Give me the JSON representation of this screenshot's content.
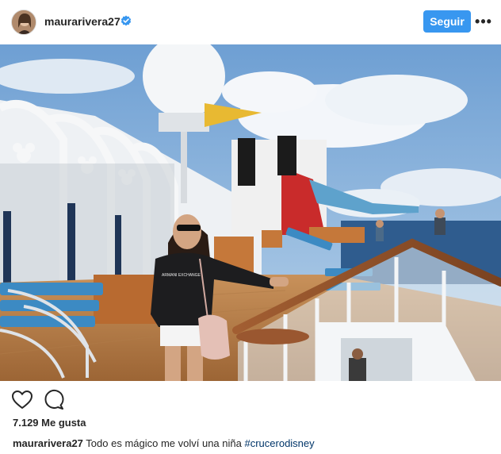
{
  "post": {
    "username": "maurarivera27",
    "verified": true,
    "follow_label": "Seguir",
    "more_icon": "more-options-icon",
    "accent_color": "#3897f0",
    "likes_text": "7.129 Me gusta",
    "caption_user": "maurarivera27",
    "caption_text": "Todo es mágico me volví una niña",
    "caption_hashtag": "#crucerodisney",
    "shirt_text": "ARMANI EXCHANGE"
  },
  "icons": {
    "like": "heart-icon",
    "comment": "comment-icon",
    "verified": "verified-badge-icon"
  }
}
